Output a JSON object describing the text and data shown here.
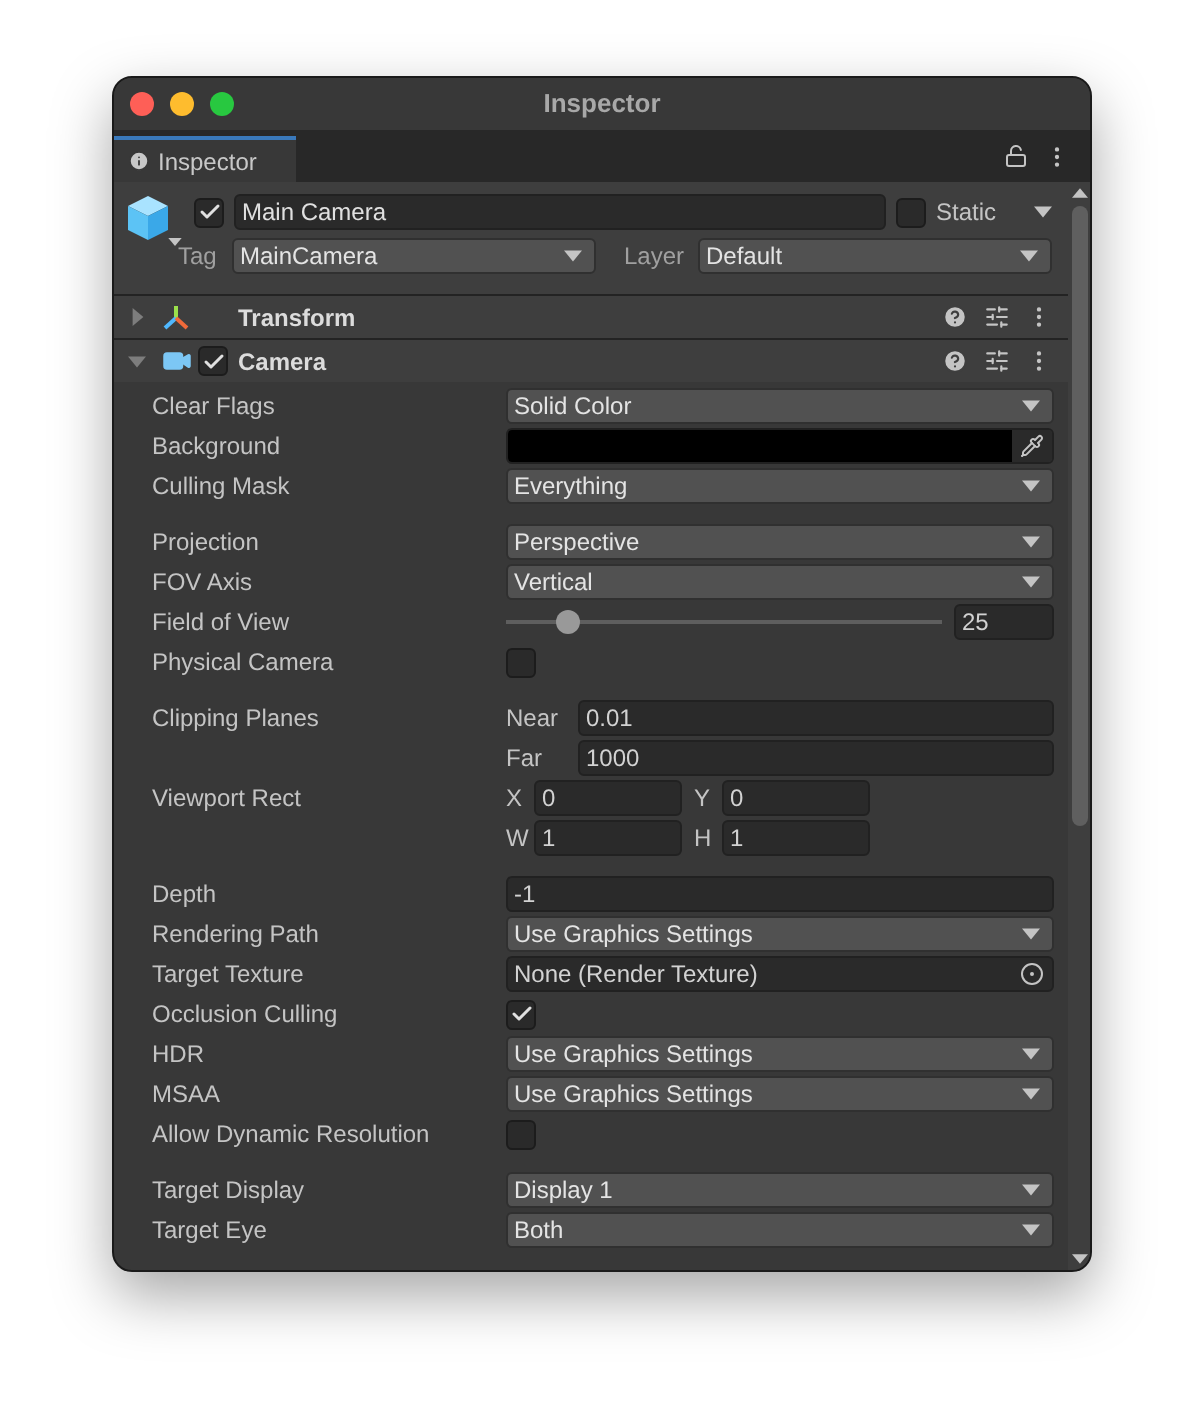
{
  "window": {
    "title": "Inspector"
  },
  "tab": {
    "label": "Inspector",
    "selected": true
  },
  "object": {
    "active": true,
    "name": "Main Camera",
    "static": false,
    "static_label": "Static",
    "tag_label": "Tag",
    "tag": "MainCamera",
    "layer_label": "Layer",
    "layer": "Default"
  },
  "components": [
    {
      "name": "Transform",
      "kind": "transform",
      "expanded": false
    },
    {
      "name": "Camera",
      "kind": "camera",
      "expanded": true,
      "enabled": true
    }
  ],
  "camera_property_groups": [
    [
      {
        "kind": "dropdown",
        "label": "Clear Flags",
        "value": "Solid Color"
      },
      {
        "kind": "color",
        "label": "Background",
        "color": "#000000"
      },
      {
        "kind": "dropdown",
        "label": "Culling Mask",
        "value": "Everything"
      }
    ],
    [
      {
        "kind": "dropdown",
        "label": "Projection",
        "value": "Perspective"
      },
      {
        "kind": "dropdown",
        "label": "FOV Axis",
        "value": "Vertical"
      },
      {
        "kind": "slider",
        "label": "Field of View",
        "level": 0.14,
        "value": "25"
      },
      {
        "kind": "checkbox",
        "label": "Physical Camera",
        "checked": false
      }
    ],
    [
      {
        "kind": "planes",
        "label": "Clipping Planes",
        "fields": [
          {
            "label": "Near",
            "value": "0.01"
          },
          {
            "label": "Far",
            "value": "1000"
          }
        ]
      },
      {
        "kind": "rect",
        "label": "Viewport Rect",
        "fields": [
          {
            "label": "X",
            "value": "0"
          },
          {
            "label": "Y",
            "value": "0"
          },
          {
            "label": "W",
            "value": "1"
          },
          {
            "label": "H",
            "value": "1"
          }
        ]
      }
    ],
    [
      {
        "kind": "number",
        "label": "Depth",
        "value": "-1"
      },
      {
        "kind": "dropdown",
        "label": "Rendering Path",
        "value": "Use Graphics Settings"
      },
      {
        "kind": "object",
        "label": "Target Texture",
        "value": "None (Render Texture)"
      },
      {
        "kind": "checkbox",
        "label": "Occlusion Culling",
        "checked": true
      },
      {
        "kind": "dropdown",
        "label": "HDR",
        "value": "Use Graphics Settings"
      },
      {
        "kind": "dropdown",
        "label": "MSAA",
        "value": "Use Graphics Settings"
      },
      {
        "kind": "checkbox",
        "label": "Allow Dynamic Resolution",
        "checked": false
      }
    ],
    [
      {
        "kind": "dropdown",
        "label": "Target Display",
        "value": "Display 1"
      },
      {
        "kind": "dropdown",
        "label": "Target Eye",
        "value": "Both"
      }
    ]
  ]
}
